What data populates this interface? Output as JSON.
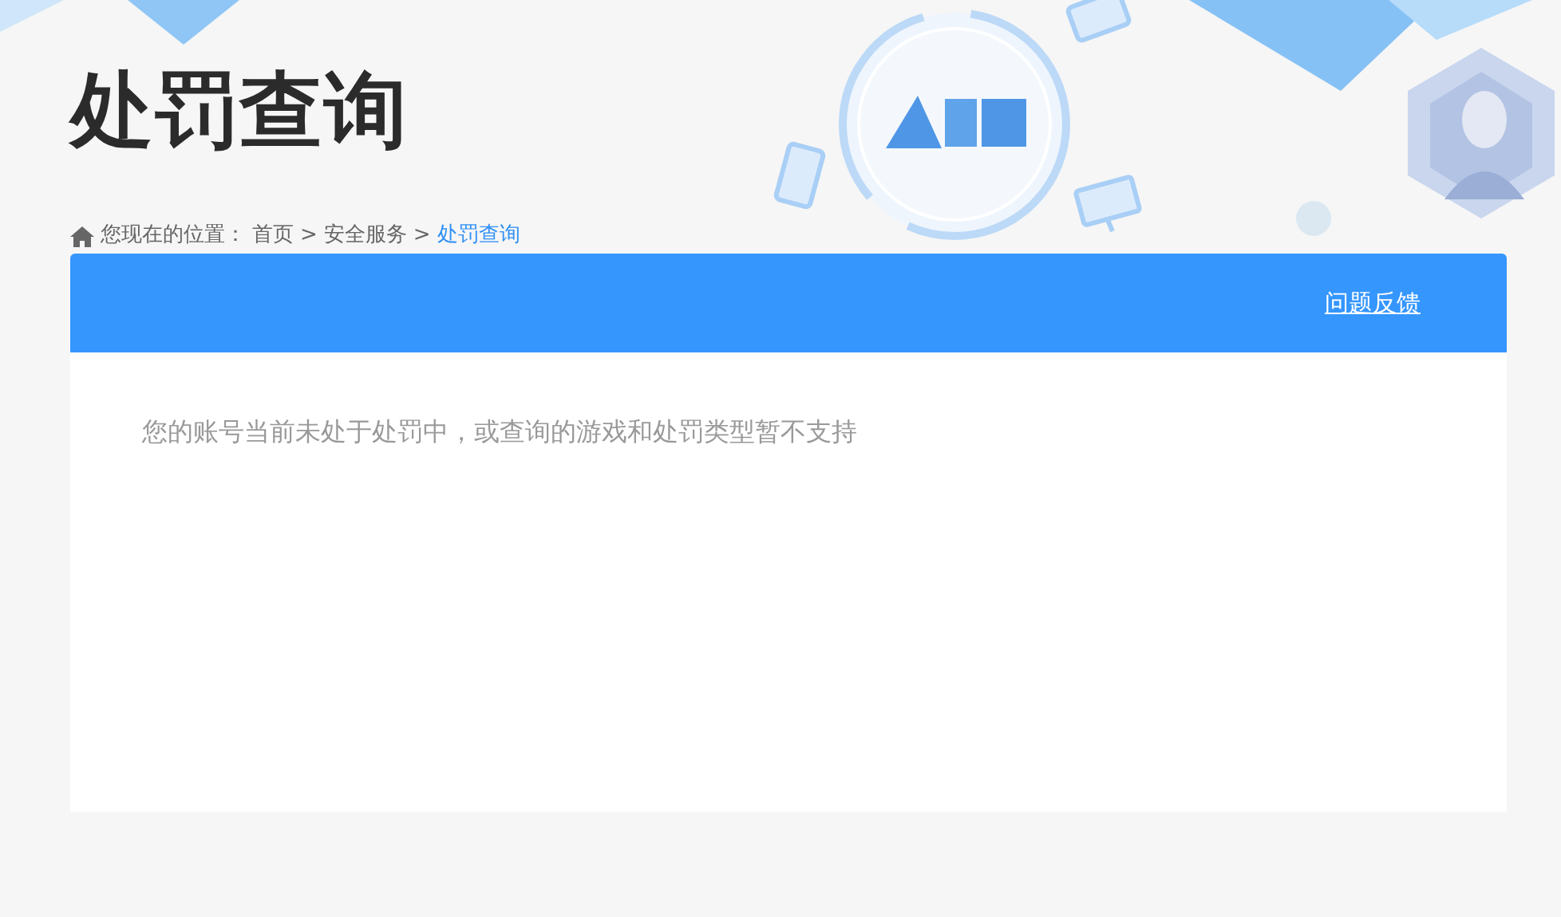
{
  "header": {
    "title": "处罚查询"
  },
  "breadcrumb": {
    "prefix": "您现在的位置：",
    "items": [
      {
        "kind": "link",
        "label": "首页",
        "selected": false
      },
      {
        "kind": "separator",
        "label": ">"
      },
      {
        "kind": "link",
        "label": "安全服务",
        "selected": false
      },
      {
        "kind": "separator",
        "label": ">"
      },
      {
        "kind": "link",
        "label": "处罚查询",
        "selected": true
      }
    ]
  },
  "panel": {
    "feedback_link": "问题反馈",
    "message": "您的账号当前未处于处罚中，或查询的游戏和处罚类型暂不支持"
  }
}
